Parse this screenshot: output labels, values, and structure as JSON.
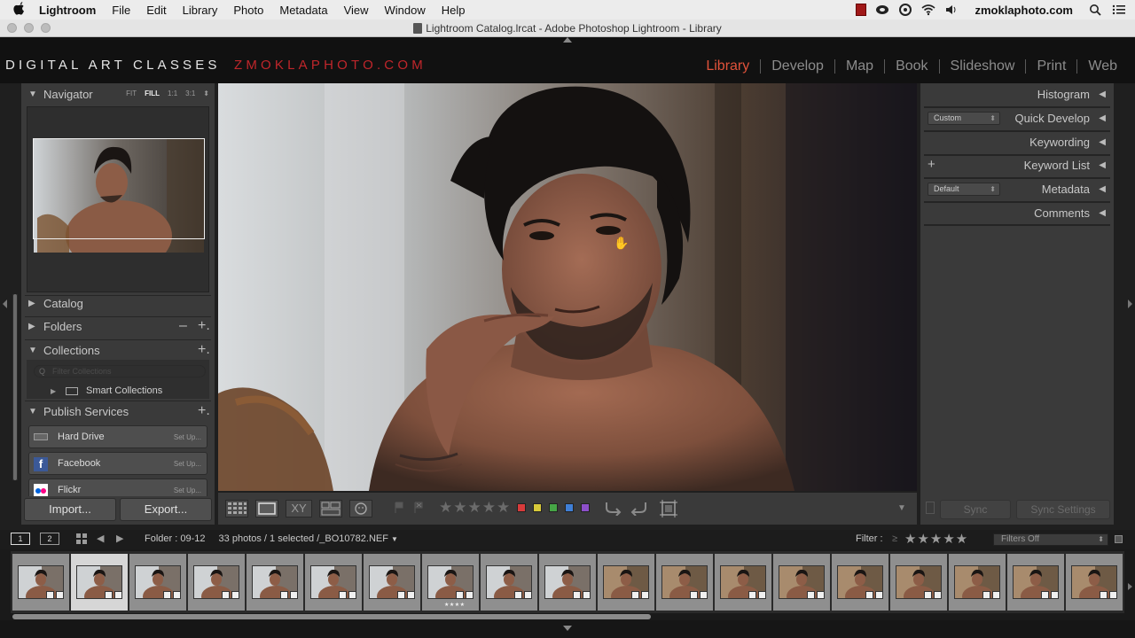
{
  "menubar": {
    "app_name": "Lightroom",
    "items": [
      "File",
      "Edit",
      "Library",
      "Photo",
      "Metadata",
      "View",
      "Window",
      "Help"
    ],
    "site": "zmoklaphoto.com"
  },
  "window": {
    "title": "Lightroom Catalog.lrcat - Adobe Photoshop Lightroom - Library"
  },
  "identity": {
    "brand_left": "DIGITAL ART CLASSES",
    "brand_right": "ZMOKLAPHOTO.COM",
    "accent": "#c0262b"
  },
  "modules": {
    "items": [
      "Library",
      "Develop",
      "Map",
      "Book",
      "Slideshow",
      "Print",
      "Web"
    ],
    "active": "Library",
    "active_color": "#e0523a"
  },
  "left_panel": {
    "navigator": {
      "title": "Navigator",
      "zoom_options": [
        "FIT",
        "FILL",
        "1:1",
        "3:1"
      ],
      "active_zoom": "FILL"
    },
    "catalog": {
      "title": "Catalog"
    },
    "folders": {
      "title": "Folders",
      "minus": "–",
      "plus": "+."
    },
    "collections": {
      "title": "Collections",
      "plus": "+.",
      "filter_placeholder": "Filter Collections",
      "smart_collections": "Smart Collections"
    },
    "publish_services": {
      "title": "Publish Services",
      "plus": "+.",
      "services": [
        {
          "name": "Hard Drive",
          "action": "Set Up..."
        },
        {
          "name": "Facebook",
          "action": "Set Up..."
        },
        {
          "name": "Flickr",
          "action": "Set Up..."
        }
      ]
    },
    "import_label": "Import...",
    "export_label": "Export..."
  },
  "toolbar": {
    "stars": "★★★★★",
    "color_labels": [
      "#d83b3b",
      "#d7c93a",
      "#46a546",
      "#3f7fd6",
      "#8d4fc9"
    ],
    "compare_label": "XY"
  },
  "right_panel": {
    "histogram": {
      "title": "Histogram"
    },
    "quick_develop": {
      "title": "Quick Develop",
      "preset": "Custom"
    },
    "keywording": {
      "title": "Keywording"
    },
    "keyword_list": {
      "title": "Keyword List",
      "plus": "+"
    },
    "metadata": {
      "title": "Metadata",
      "preset": "Default"
    },
    "comments": {
      "title": "Comments"
    },
    "sync_label": "Sync",
    "sync_settings_label": "Sync Settings"
  },
  "filmstrip_header": {
    "monitor1": "1",
    "monitor2": "2",
    "folder": "Folder : 09-12",
    "count": "33 photos / 1 selected /",
    "filename": "_BO10782.NEF",
    "filter_label": "Filter :",
    "filter_ge": "≥",
    "filter_stars": "★★★★★",
    "filter_state": "Filters Off"
  },
  "filmstrip": {
    "selected_index": 1,
    "thumb_count": 19,
    "stars_on_index": 7,
    "stars_text": "★★★★"
  }
}
